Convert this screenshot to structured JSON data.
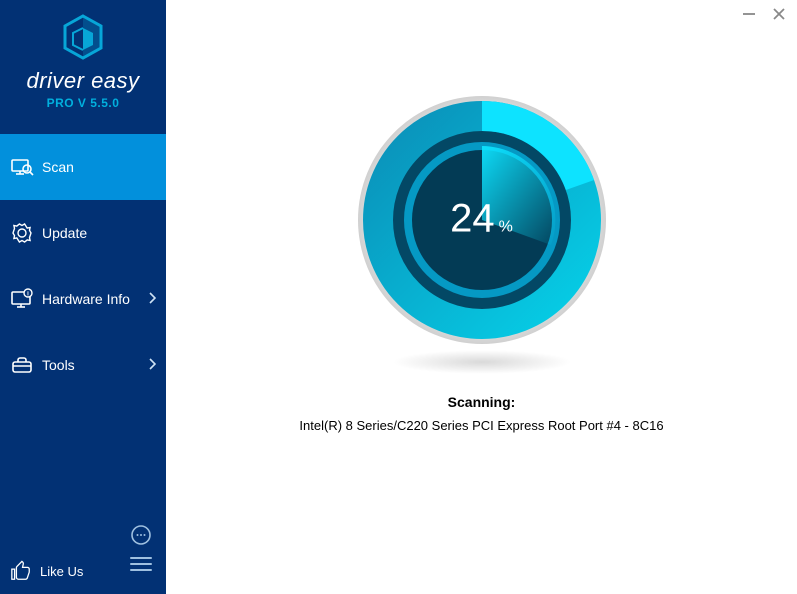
{
  "brand": {
    "name": "driver easy",
    "version": "PRO V 5.5.0"
  },
  "sidebar": {
    "items": [
      {
        "label": "Scan"
      },
      {
        "label": "Update"
      },
      {
        "label": "Hardware Info"
      },
      {
        "label": "Tools"
      }
    ],
    "likeus_label": "Like Us"
  },
  "main": {
    "progress_value": "24",
    "progress_unit": "%",
    "status_label": "Scanning:",
    "status_detail": "Intel(R) 8 Series/C220 Series PCI Express Root Port #4 - 8C16"
  },
  "colors": {
    "sidebar_bg": "#023174",
    "active_bg": "#0290dc",
    "accent": "#01b0de"
  }
}
